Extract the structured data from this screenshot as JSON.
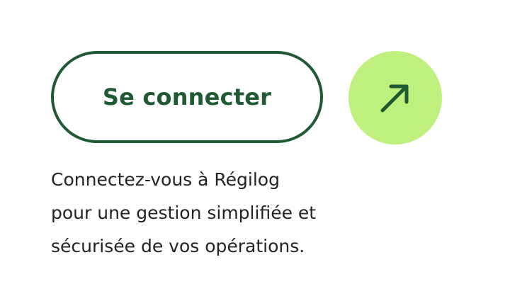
{
  "login_card": {
    "button_label": "Se connecter",
    "arrow_icon": "arrow-up-right-icon",
    "description_lines": [
      "Connectez-vous à Régilog",
      "pour une gestion simplifiée et",
      "sécurisée de vos opérations."
    ]
  },
  "colors": {
    "primary_green": "#1f5a33",
    "accent_lime": "#bff07d",
    "text": "#232323",
    "background": "#ffffff"
  }
}
